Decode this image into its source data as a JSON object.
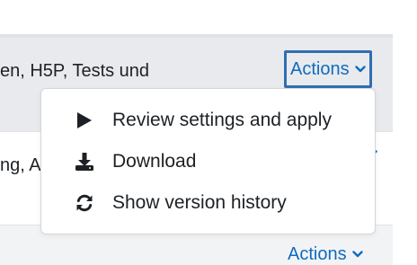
{
  "rows": [
    {
      "text": "en, H5P, Tests und",
      "actions_label": "Actions"
    },
    {
      "text": "ng, A",
      "actions_label": ""
    },
    {
      "text": "",
      "actions_label": "Actions"
    }
  ],
  "menu": {
    "items": [
      {
        "label": "Review settings and apply",
        "icon": "play-icon"
      },
      {
        "label": "Download",
        "icon": "download-icon"
      },
      {
        "label": "Show version history",
        "icon": "refresh-icon"
      }
    ]
  },
  "colors": {
    "link": "#0f6cbf",
    "focus_border": "#2f6fb3",
    "row_highlight": "#e9eaed"
  }
}
